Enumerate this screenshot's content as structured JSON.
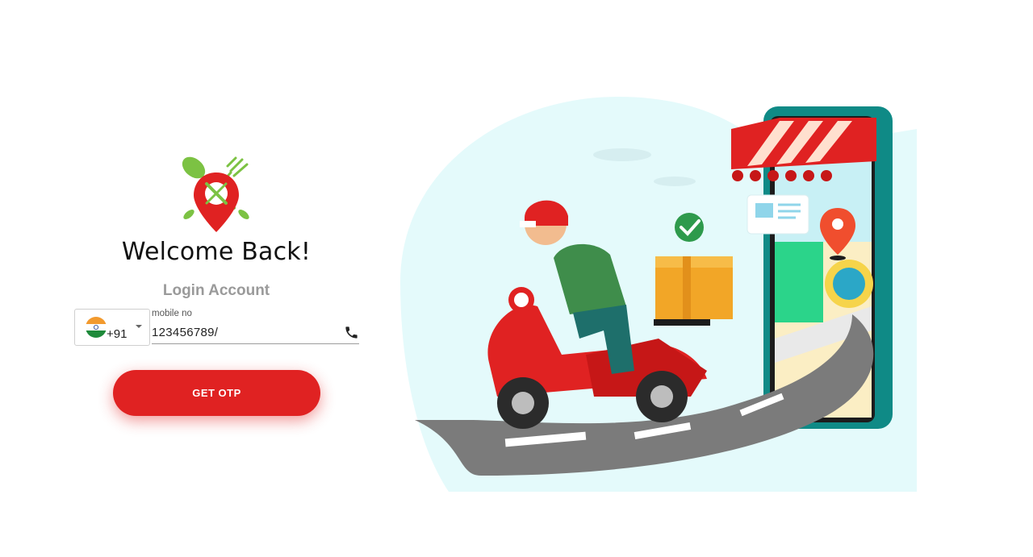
{
  "welcome": {
    "title": "Welcome Back!",
    "subtitle": "Login Account"
  },
  "phone_form": {
    "country_flag_icon": "india-flag-icon",
    "dial_code": "+91",
    "mobile_label": "mobile no",
    "mobile_value": "123456789/",
    "phone_icon": "phone-icon"
  },
  "actions": {
    "get_otp_label": "GET OTP"
  },
  "colors": {
    "brand_red": "#e02222",
    "logo_green": "#7cc243",
    "illustration_bg": "#e4fafb"
  }
}
